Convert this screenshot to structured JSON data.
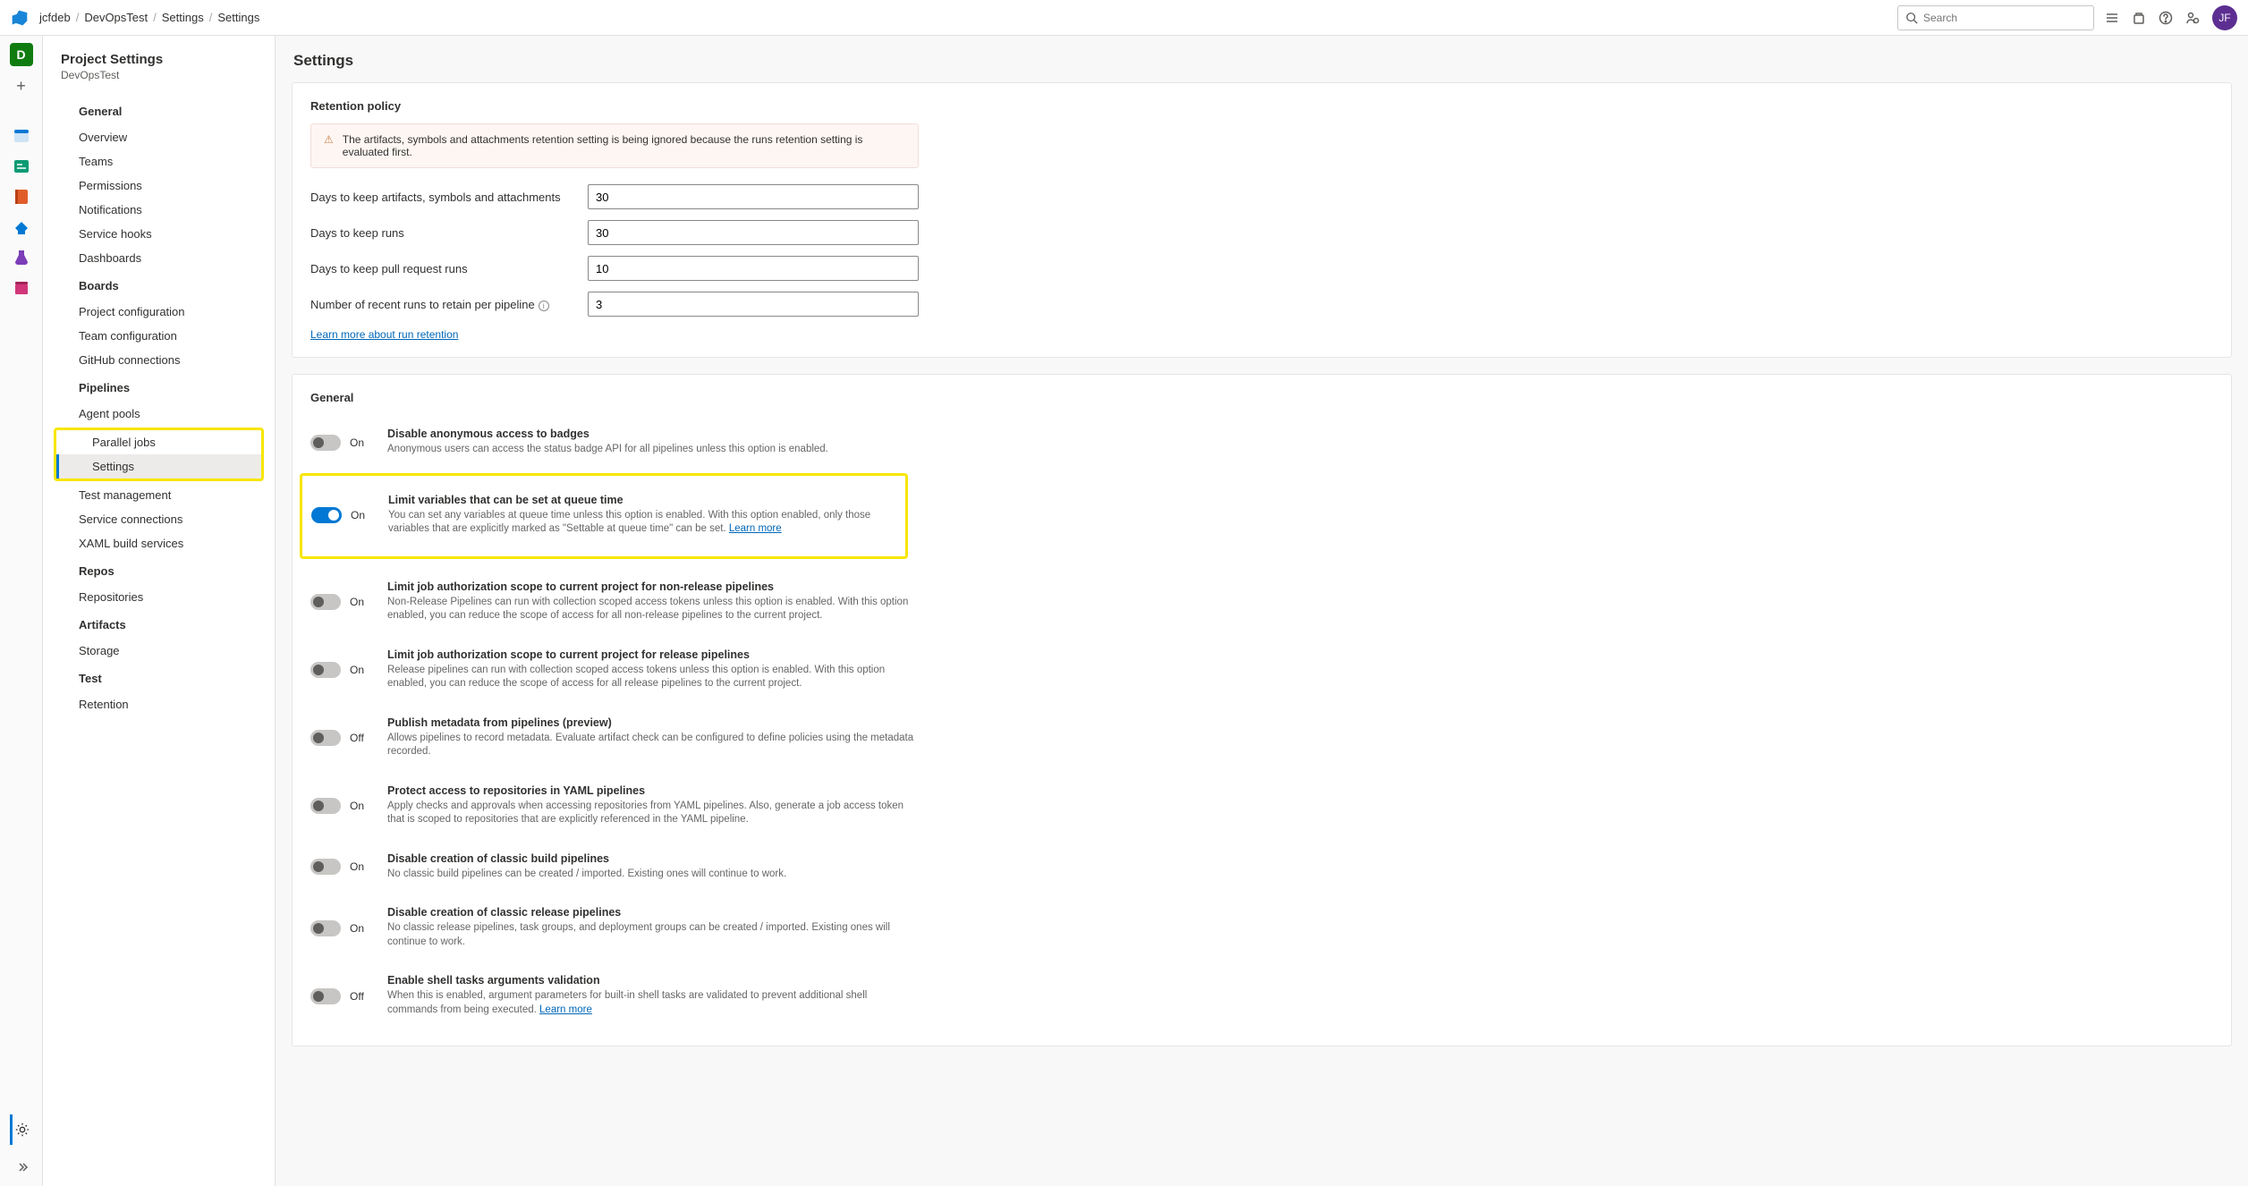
{
  "topbar": {
    "breadcrumb": {
      "org": "jcfdeb",
      "project": "DevOpsTest",
      "section": "Settings",
      "page": "Settings"
    },
    "search_placeholder": "Search",
    "avatar_initials": "JF"
  },
  "iconrail": {
    "project_initial": "D",
    "plus": "+"
  },
  "sidebar": {
    "title": "Project Settings",
    "subtitle": "DevOpsTest",
    "groups": [
      {
        "name": "General",
        "items": [
          "Overview",
          "Teams",
          "Permissions",
          "Notifications",
          "Service hooks",
          "Dashboards"
        ]
      },
      {
        "name": "Boards",
        "items": [
          "Project configuration",
          "Team configuration",
          "GitHub connections"
        ]
      },
      {
        "name": "Pipelines",
        "items": [
          "Agent pools",
          "Parallel jobs",
          "Settings",
          "Test management",
          "Service connections",
          "XAML build services"
        ],
        "active": "Settings"
      },
      {
        "name": "Repos",
        "items": [
          "Repositories"
        ]
      },
      {
        "name": "Artifacts",
        "items": [
          "Storage"
        ]
      },
      {
        "name": "Test",
        "items": [
          "Retention"
        ]
      }
    ]
  },
  "main": {
    "title": "Settings",
    "retention": {
      "heading": "Retention policy",
      "warning": "The artifacts, symbols and attachments retention setting is being ignored because the runs retention setting is evaluated first.",
      "rows": [
        {
          "label": "Days to keep artifacts, symbols and attachments",
          "value": "30"
        },
        {
          "label": "Days to keep runs",
          "value": "30"
        },
        {
          "label": "Days to keep pull request runs",
          "value": "10"
        },
        {
          "label": "Number of recent runs to retain per pipeline",
          "value": "3",
          "info": true
        }
      ],
      "learn_more": "Learn more about run retention"
    },
    "general": {
      "heading": "General",
      "toggles": [
        {
          "on": false,
          "state": "On",
          "title": "Disable anonymous access to badges",
          "desc": "Anonymous users can access the status badge API for all pipelines unless this option is enabled."
        },
        {
          "on": true,
          "state": "On",
          "title": "Limit variables that can be set at queue time",
          "highlight": true,
          "desc": "You can set any variables at queue time unless this option is enabled. With this option enabled, only those variables that are explicitly marked as \"Settable at queue time\" can be set.",
          "link": "Learn more"
        },
        {
          "on": false,
          "state": "On",
          "title": "Limit job authorization scope to current project for non-release pipelines",
          "desc": "Non-Release Pipelines can run with collection scoped access tokens unless this option is enabled. With this option enabled, you can reduce the scope of access for all non-release pipelines to the current project."
        },
        {
          "on": false,
          "state": "On",
          "title": "Limit job authorization scope to current project for release pipelines",
          "desc": "Release pipelines can run with collection scoped access tokens unless this option is enabled. With this option enabled, you can reduce the scope of access for all release pipelines to the current project."
        },
        {
          "on": false,
          "state": "Off",
          "title": "Publish metadata from pipelines (preview)",
          "desc": "Allows pipelines to record metadata. Evaluate artifact check can be configured to define policies using the metadata recorded."
        },
        {
          "on": false,
          "state": "On",
          "title": "Protect access to repositories in YAML pipelines",
          "desc": "Apply checks and approvals when accessing repositories from YAML pipelines. Also, generate a job access token that is scoped to repositories that are explicitly referenced in the YAML pipeline."
        },
        {
          "on": false,
          "state": "On",
          "title": "Disable creation of classic build pipelines",
          "desc": "No classic build pipelines can be created / imported. Existing ones will continue to work."
        },
        {
          "on": false,
          "state": "On",
          "title": "Disable creation of classic release pipelines",
          "desc": "No classic release pipelines, task groups, and deployment groups can be created / imported. Existing ones will continue to work."
        },
        {
          "on": false,
          "state": "Off",
          "title": "Enable shell tasks arguments validation",
          "desc": "When this is enabled, argument parameters for built-in shell tasks are validated to prevent additional shell commands from being executed.",
          "link": "Learn more"
        }
      ]
    }
  }
}
